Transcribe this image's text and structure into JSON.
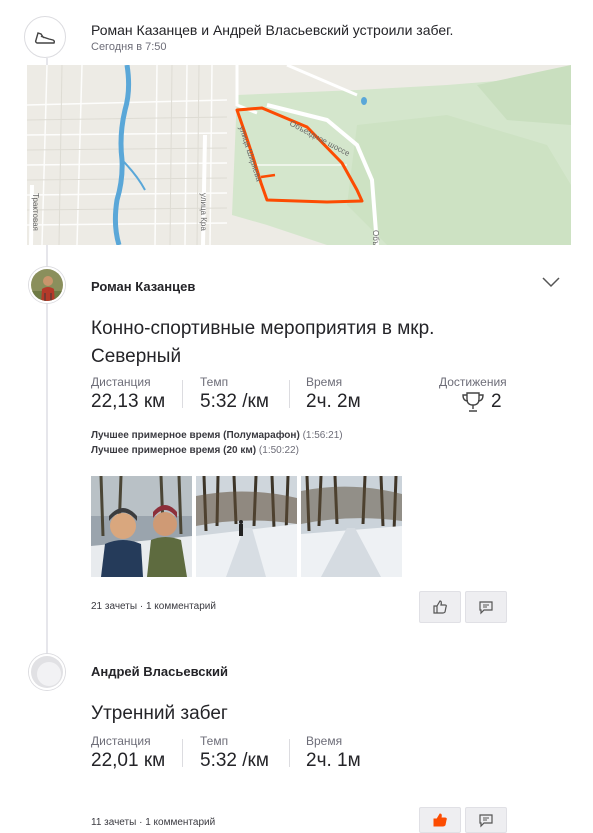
{
  "group": {
    "title": "Роман Казанцев и Андрей Власьевский устроили забег.",
    "time": "Сегодня в 7:50"
  },
  "map": {
    "labels": [
      "Объездное шоссе",
      "улица Ширяева",
      "Трактовая",
      "улица Кра",
      "Объ"
    ],
    "route_color": "#fc4c02"
  },
  "activities": [
    {
      "athlete": "Роман Казанцев",
      "title": "Конно-спортивные мероприятия в мкр. Северный",
      "stats": [
        {
          "label": "Дистанция",
          "value": "22,13 км"
        },
        {
          "label": "Темп",
          "value": "5:32 /км"
        },
        {
          "label": "Время",
          "value": "2ч. 2м"
        }
      ],
      "achievements": {
        "label": "Достижения",
        "value": "2"
      },
      "best_efforts": [
        {
          "text": "Лучшее примерное время (Полумарафон)",
          "time": "(1:56:21)"
        },
        {
          "text": "Лучшее примерное время (20 км)",
          "time": "(1:50:22)"
        }
      ],
      "kudos": "21 зачеты",
      "comments": "1 комментарий",
      "kudos_given": false
    },
    {
      "athlete": "Андрей Власьевский",
      "title": "Утренний забег",
      "stats": [
        {
          "label": "Дистанция",
          "value": "22,01 км"
        },
        {
          "label": "Темп",
          "value": "5:32 /км"
        },
        {
          "label": "Время",
          "value": "2ч. 1м"
        }
      ],
      "kudos": "11 зачеты",
      "comments": "1 комментарий",
      "kudos_given": true
    }
  ],
  "social_separator": "·",
  "colors": {
    "accent": "#fc4c02",
    "button_bg": "#eeeef1",
    "text": "#242428",
    "muted": "#6d6d78"
  }
}
